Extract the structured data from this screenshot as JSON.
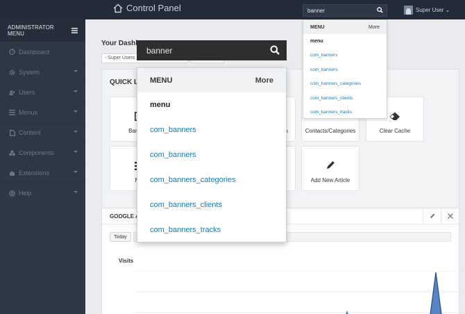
{
  "topbar": {
    "title": "Control Panel",
    "search_value": "banner",
    "user_label": "Super User ⌄"
  },
  "small_dropdown": {
    "header": "MENU",
    "more": "More",
    "group": "menu",
    "items": [
      "com_banners",
      "com_banners",
      "com_banners_categories",
      "com_banners_clients",
      "com_banners_tracks"
    ]
  },
  "sidebar": {
    "header": "ADMINISTRATOR MENU",
    "items": [
      {
        "label": "Dashboard",
        "icon": "dashboard-icon"
      },
      {
        "label": "System",
        "icon": "gear-icon"
      },
      {
        "label": "Users",
        "icon": "users-icon"
      },
      {
        "label": "Menus",
        "icon": "list-icon"
      },
      {
        "label": "Content",
        "icon": "file-icon"
      },
      {
        "label": "Components",
        "icon": "cubes-icon"
      },
      {
        "label": "Extensions",
        "icon": "puzzle-icon"
      },
      {
        "label": "Help",
        "icon": "help-icon"
      }
    ]
  },
  "main": {
    "dashboard_title": "Your Dashb",
    "select_value": "- Super Users",
    "quick_links_title": "QUICK LI",
    "tiles": {
      "banners": "Banners",
      "s": "s",
      "contacts": "Contacts/Categories",
      "clear_cache": "Clear Cache",
      "me": "Me",
      "add_article": "Add New Article"
    },
    "ga_title": "GOOGLE A",
    "today_button": "Today",
    "visits_label": "Visits"
  },
  "big_dropdown": {
    "search_value": "banner",
    "header": "MENU",
    "more": "More",
    "group": "menu",
    "items": [
      "com_banners",
      "com_banners",
      "com_banners_categories",
      "com_banners_clients",
      "com_banners_tracks"
    ]
  },
  "colors": {
    "topbar": "#222b37",
    "sidebar": "#2e3845",
    "link": "#1a7bb9",
    "chart": "#3b6fb6"
  }
}
